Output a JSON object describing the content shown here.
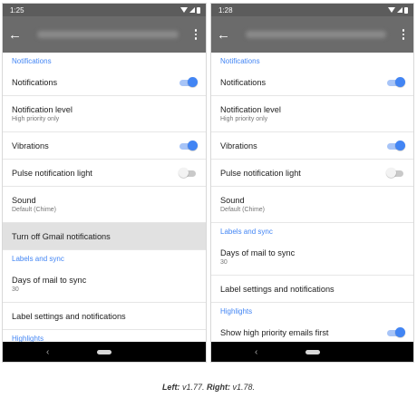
{
  "left": {
    "time": "1:25",
    "sections": [
      {
        "header": "Notifications",
        "rows": [
          {
            "label": "Notifications",
            "toggle": "on"
          },
          {
            "label": "Notification level",
            "sub": "High priority only"
          },
          {
            "label": "Vibrations",
            "toggle": "on"
          },
          {
            "label": "Pulse notification light",
            "toggle": "off"
          },
          {
            "label": "Sound",
            "sub": "Default (Chime)"
          },
          {
            "label": "Turn off Gmail notifications",
            "highlight": true
          }
        ]
      },
      {
        "header": "Labels and sync",
        "rows": [
          {
            "label": "Days of mail to sync",
            "sub": "30"
          },
          {
            "label": "Label settings and notifications"
          }
        ]
      },
      {
        "header": "Highlights",
        "rows": []
      }
    ]
  },
  "right": {
    "time": "1:28",
    "sections": [
      {
        "header": "Notifications",
        "rows": [
          {
            "label": "Notifications",
            "toggle": "on"
          },
          {
            "label": "Notification level",
            "sub": "High priority only"
          },
          {
            "label": "Vibrations",
            "toggle": "on"
          },
          {
            "label": "Pulse notification light",
            "toggle": "off"
          },
          {
            "label": "Sound",
            "sub": "Default (Chime)"
          }
        ]
      },
      {
        "header": "Labels and sync",
        "rows": [
          {
            "label": "Days of mail to sync",
            "sub": "30"
          },
          {
            "label": "Label settings and notifications"
          }
        ]
      },
      {
        "header": "Highlights",
        "rows": [
          {
            "label": "Show high priority emails first",
            "toggle": "on"
          }
        ]
      }
    ]
  },
  "caption": {
    "left_label": "Left:",
    "left_version": "v1.77.",
    "right_label": "Right:",
    "right_version": "v1.78."
  },
  "colors": {
    "accent": "#4285f4",
    "appbar": "#6b6b6b",
    "statusbar": "#5c5c5c"
  },
  "icons": {
    "back": "arrow-back-icon",
    "more": "more-vert-icon",
    "nav_back": "nav-back-icon",
    "nav_home": "nav-home-icon"
  }
}
